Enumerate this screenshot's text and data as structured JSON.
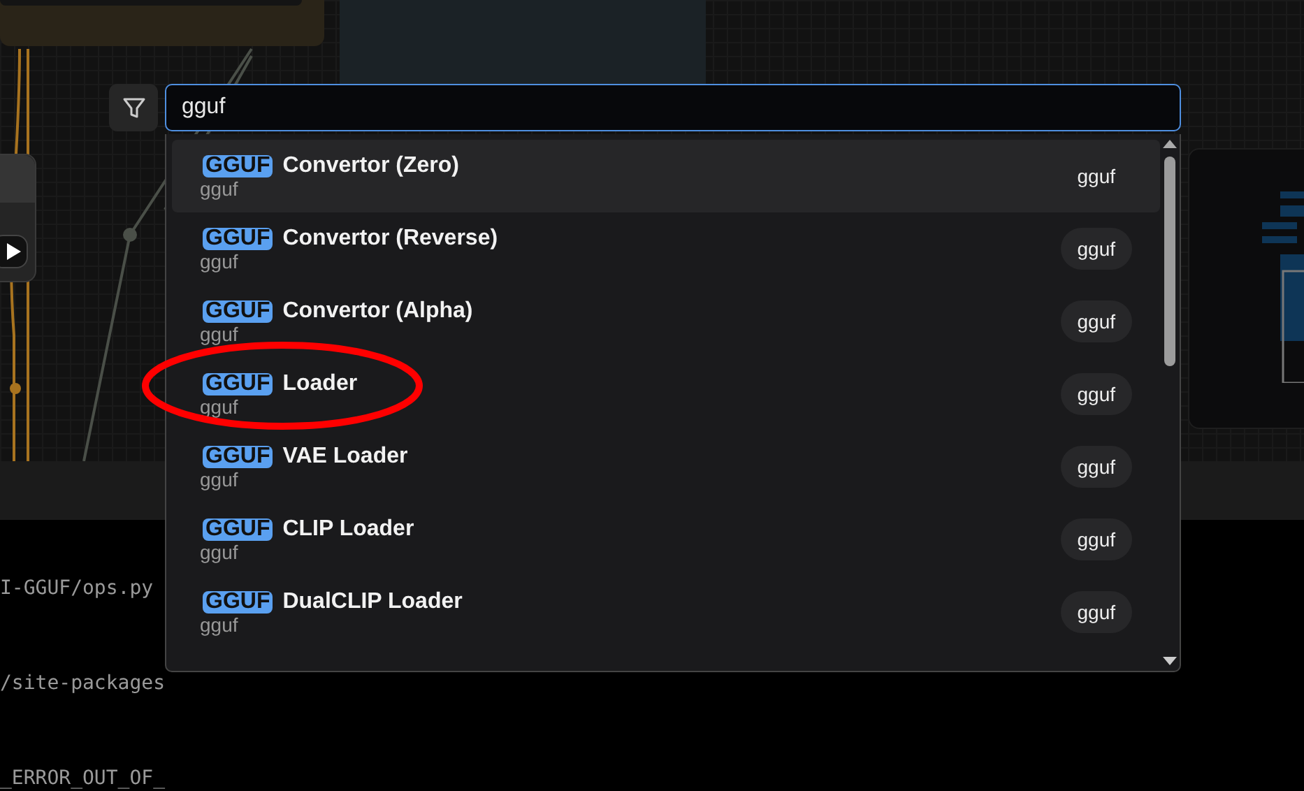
{
  "search": {
    "value": "gguf"
  },
  "results": [
    {
      "badge": "GGUF",
      "title": "Convertor (Zero)",
      "category": "gguf",
      "chip": "gguf",
      "selected": true
    },
    {
      "badge": "GGUF",
      "title": "Convertor (Reverse)",
      "category": "gguf",
      "chip": "gguf",
      "selected": false
    },
    {
      "badge": "GGUF",
      "title": "Convertor (Alpha)",
      "category": "gguf",
      "chip": "gguf",
      "selected": false
    },
    {
      "badge": "GGUF",
      "title": "Loader",
      "category": "gguf",
      "chip": "gguf",
      "selected": false
    },
    {
      "badge": "GGUF",
      "title": "VAE Loader",
      "category": "gguf",
      "chip": "gguf",
      "selected": false
    },
    {
      "badge": "GGUF",
      "title": "CLIP Loader",
      "category": "gguf",
      "chip": "gguf",
      "selected": false
    },
    {
      "badge": "GGUF",
      "title": "DualCLIP Loader",
      "category": "gguf",
      "chip": "gguf",
      "selected": false
    }
  ],
  "terminal": {
    "lines": [
      "I-GGUF/ops.py",
      "/site-packages",
      "_ERROR_OUT_OF_"
    ]
  }
}
